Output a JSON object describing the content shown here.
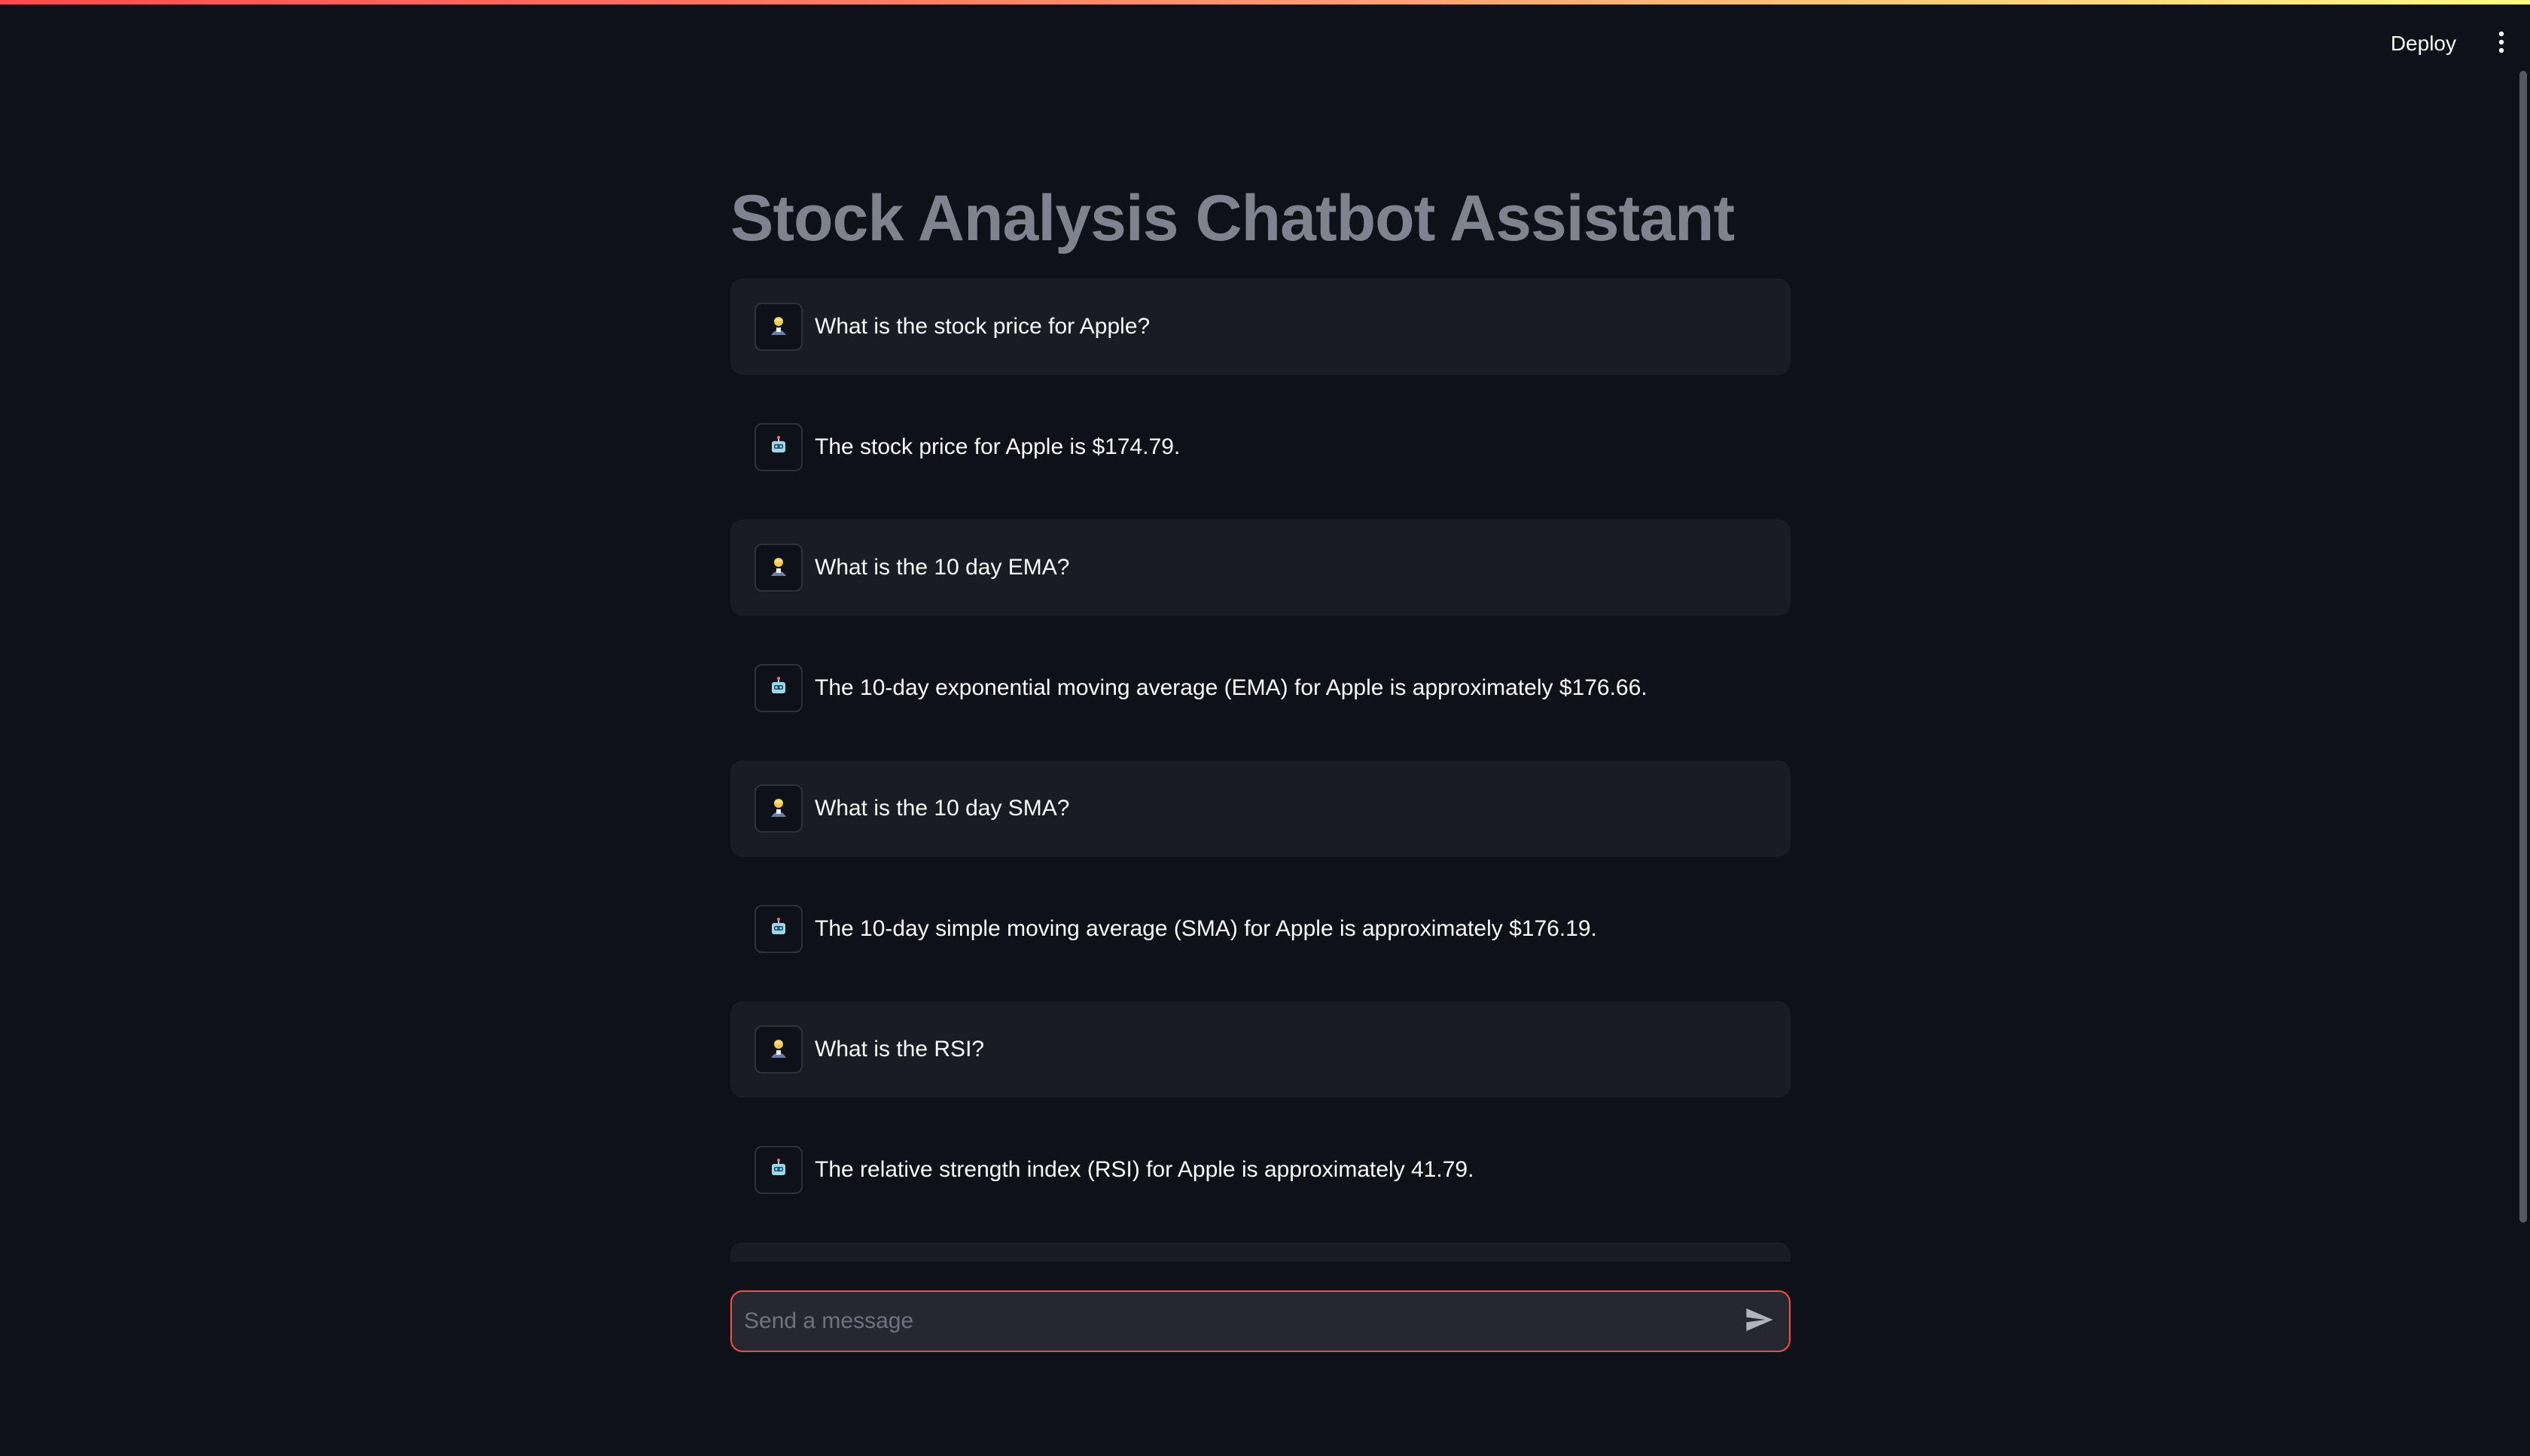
{
  "header": {
    "deploy_label": "Deploy",
    "menu_icon": "more-vertical-icon"
  },
  "main": {
    "title": "Stock Analysis Chatbot Assistant"
  },
  "messages": [
    {
      "role": "user",
      "avatar_icon": "user-avatar-icon",
      "text": "What is the stock price for Apple?"
    },
    {
      "role": "assistant",
      "avatar_icon": "robot-avatar-icon",
      "text": "The stock price for Apple is $174.79."
    },
    {
      "role": "user",
      "avatar_icon": "user-avatar-icon",
      "text": "What is the 10 day EMA?"
    },
    {
      "role": "assistant",
      "avatar_icon": "robot-avatar-icon",
      "text": "The 10-day exponential moving average (EMA) for Apple is approximately $176.66."
    },
    {
      "role": "user",
      "avatar_icon": "user-avatar-icon",
      "text": "What is the 10 day SMA?"
    },
    {
      "role": "assistant",
      "avatar_icon": "robot-avatar-icon",
      "text": "The 10-day simple moving average (SMA) for Apple is approximately $176.19."
    },
    {
      "role": "user",
      "avatar_icon": "user-avatar-icon",
      "text": "What is the RSI?"
    },
    {
      "role": "assistant",
      "avatar_icon": "robot-avatar-icon",
      "text": "The relative strength index (RSI) for Apple is approximately 41.79."
    }
  ],
  "chat_input": {
    "value": "",
    "placeholder": "Send a message",
    "send_icon": "send-icon"
  },
  "colors": {
    "background": "#0e1117",
    "user_message_bg": "#1a1c24",
    "accent": "#ff4b4b",
    "title": "#7f8390"
  }
}
